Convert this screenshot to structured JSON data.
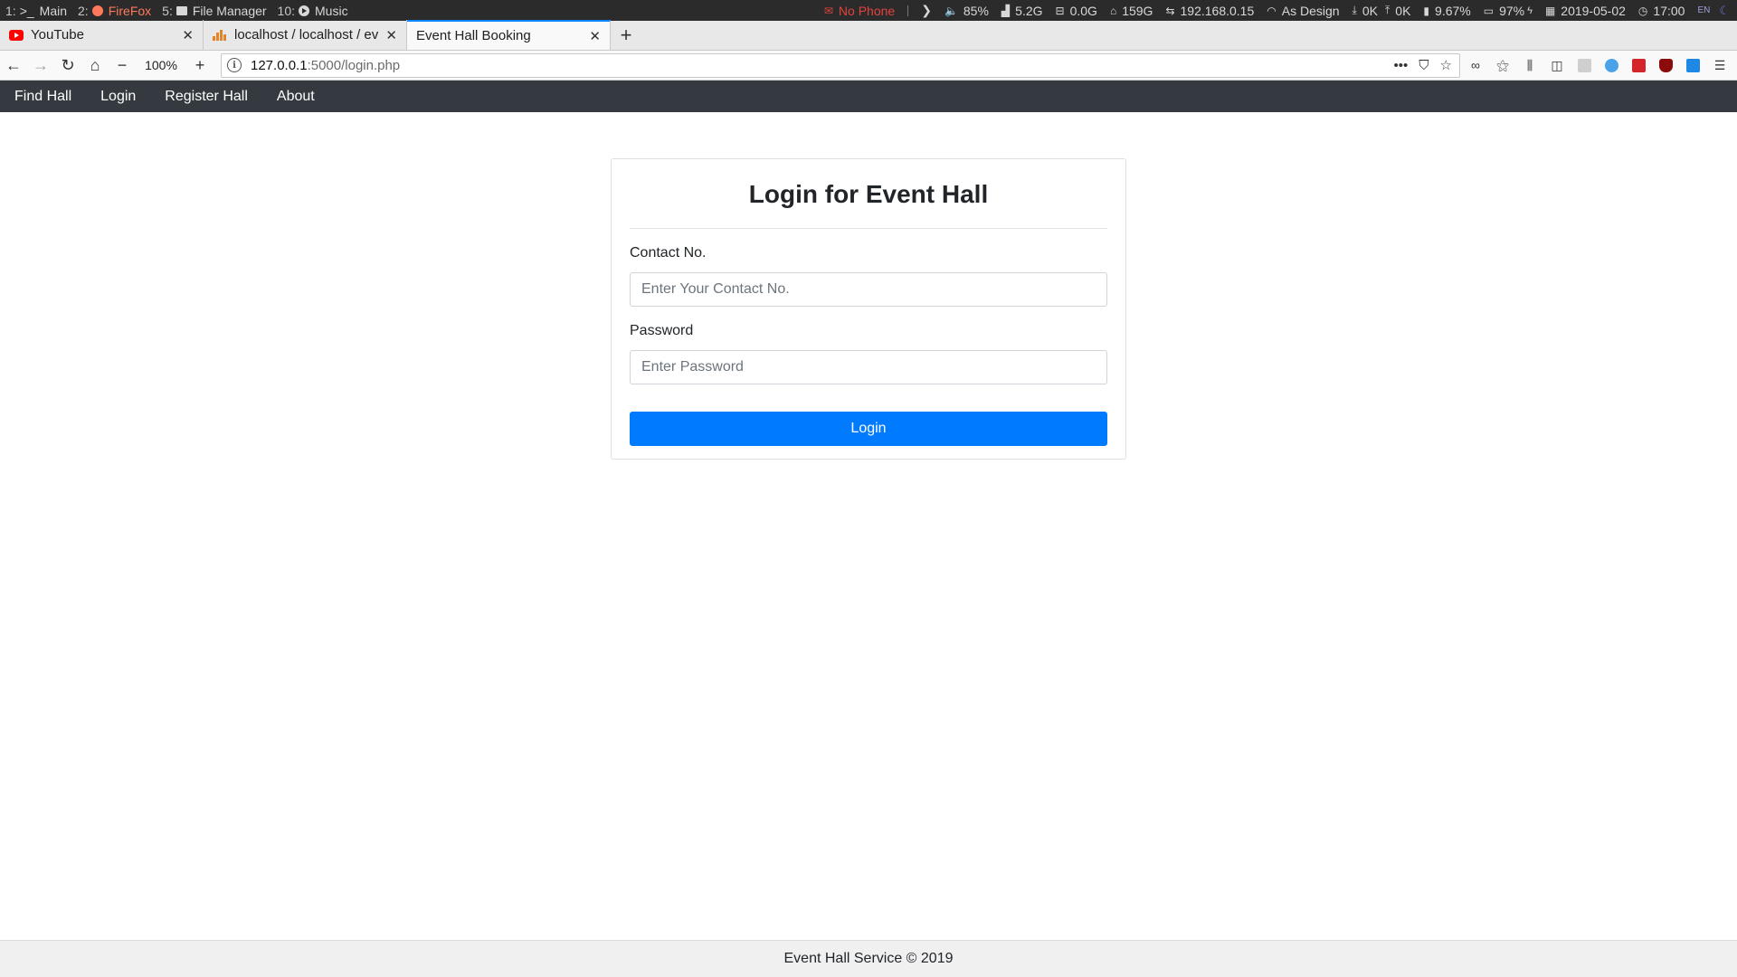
{
  "system_bar": {
    "workspaces": [
      {
        "num": "1:",
        "label": "Main",
        "icon": ">_"
      },
      {
        "num": "2:",
        "label": "FireFox",
        "icon": "firefox-icon"
      },
      {
        "num": "5:",
        "label": "File Manager",
        "icon": "folder-icon"
      },
      {
        "num": "10:",
        "label": "Music",
        "icon": "play-icon"
      }
    ],
    "phone": "No Phone",
    "volume": "85%",
    "memory": "5.2G",
    "swap": "0.0G",
    "home_disk": "159G",
    "ip": "192.168.0.15",
    "wifi": "As Design",
    "download": "0K",
    "upload": "0K",
    "cpu": "9.67%",
    "battery": "97%",
    "date": "2019-05-02",
    "time": "17:00",
    "lang": "EN",
    "colors": {
      "alert": "#e2433c",
      "active_workspace": "#ff7a5a"
    }
  },
  "browser": {
    "tabs": [
      {
        "label": "YouTube",
        "icon": "youtube-icon"
      },
      {
        "label": "localhost / localhost / ev",
        "icon": "phpmyadmin-icon"
      },
      {
        "label": "Event Hall Booking",
        "icon": "none",
        "active": true
      }
    ],
    "zoom": "100%",
    "url_host": "127.0.0.1",
    "url_path": ":5000/login.php",
    "more_label": "•••",
    "accent": "#0a84ff"
  },
  "site_nav": {
    "items": [
      "Find Hall",
      "Login",
      "Register Hall",
      "About"
    ],
    "background": "#343a40"
  },
  "login_form": {
    "title": "Login for Event Hall",
    "contact_label": "Contact No.",
    "contact_placeholder": "Enter Your Contact No.",
    "password_label": "Password",
    "password_placeholder": "Enter Password",
    "submit_label": "Login",
    "button_color": "#007bff"
  },
  "footer": {
    "text": "Event Hall Service © 2019"
  }
}
